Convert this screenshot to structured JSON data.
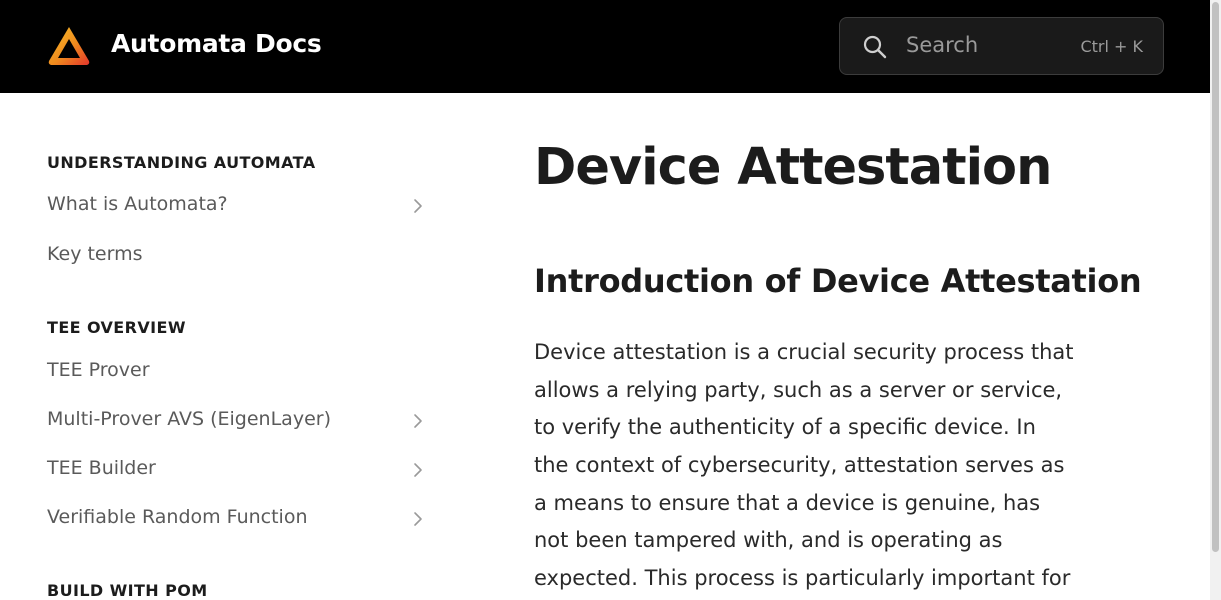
{
  "header": {
    "brand": "Automata Docs",
    "search_placeholder": "Search",
    "search_shortcut": "Ctrl + K"
  },
  "colors": {
    "header_bg": "#000000",
    "logo_gradient_start": "#f6b21b",
    "logo_gradient_end": "#e2352b",
    "text": "#1c1c1c",
    "nav_text": "#5a5a5a"
  },
  "icons": {
    "logo": "automata-logo-icon",
    "search": "search-icon",
    "chevron": "chevron-right-icon"
  },
  "sidebar": {
    "sections": [
      {
        "title": "UNDERSTANDING AUTOMATA",
        "items": [
          {
            "label": "What is Automata?",
            "has_children": true
          },
          {
            "label": "Key terms",
            "has_children": false
          }
        ]
      },
      {
        "title": "TEE OVERVIEW",
        "items": [
          {
            "label": "TEE Prover",
            "has_children": false
          },
          {
            "label": "Multi-Prover AVS (EigenLayer)",
            "has_children": true
          },
          {
            "label": "TEE Builder",
            "has_children": true
          },
          {
            "label": "Verifiable Random Function",
            "has_children": true
          }
        ]
      },
      {
        "title": "BUILD WITH POM",
        "items": []
      }
    ]
  },
  "main": {
    "title": "Device Attestation",
    "heading": "Introduction of Device Attestation",
    "paragraph_lines": [
      "Device attestation is a crucial security process that",
      "allows a relying party, such as a server or service,",
      "to verify the authenticity of a specific device. In",
      "the context of cybersecurity, attestation serves as",
      "a means to ensure that a device is genuine, has",
      "not been tampered with, and is operating as",
      "expected. This process is particularly important for"
    ]
  }
}
